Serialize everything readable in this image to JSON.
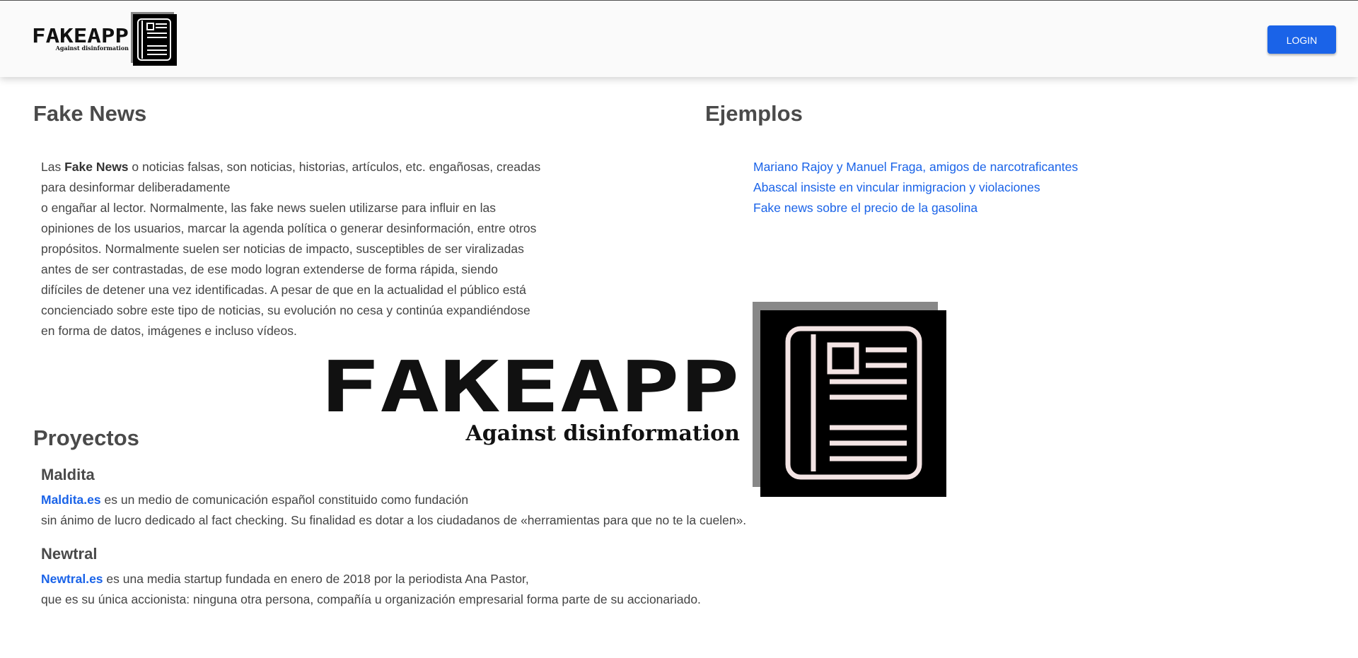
{
  "header": {
    "logo": {
      "word": "FAKEAPP",
      "tagline": "Against disinformation",
      "icon": "newspaper-icon"
    },
    "login_label": "LOGIN"
  },
  "fake_news": {
    "title": "Fake News",
    "intro": "Las ",
    "term": "Fake News",
    "line1_rest": " o noticias falsas, son noticias, historias, artículos, etc. engañosas, creadas",
    "lines": [
      "para desinformar deliberadamente",
      "o engañar al lector. Normalmente, las fake news suelen utilizarse para influir en las",
      "opiniones de los usuarios, marcar la agenda política o generar desinformación, entre otros",
      "propósitos. Normalmente suelen ser noticias de impacto, susceptibles de ser viralizadas",
      "antes de ser contrastadas, de ese modo logran extenderse de forma rápida, siendo",
      "difíciles de detener una vez identificadas. A pesar de que en la actualidad el público está",
      "concienciado sobre este tipo de noticias, su evolución no cesa y continúa expandiéndose",
      "en forma de datos, imágenes e incluso vídeos."
    ]
  },
  "ejemplos": {
    "title": "Ejemplos",
    "links": [
      "Mariano Rajoy y Manuel Fraga, amigos de narcotraficantes",
      "Abascal insiste en vincular inmigracion y violaciones",
      "Fake news sobre el precio de la gasolina"
    ]
  },
  "proyectos": {
    "title": "Proyectos",
    "maldita": {
      "name": "Maldita",
      "link": "Maldita.es",
      "line1": " es un medio de comunicación español constituido como fundación",
      "line2": "sin ánimo de lucro dedicado al fact checking. Su finalidad es dotar a los ciudadanos de «herramientas para que no te la cuelen»."
    },
    "newtral": {
      "name": "Newtral",
      "link": "Newtral.es",
      "line1": " es una media startup fundada en enero de 2018 por la periodista Ana Pastor,",
      "line2": "que es su única accionista: ninguna otra persona, compañía u organización empresarial forma parte de su accionariado."
    }
  },
  "hero_logo": {
    "word": "FAKEAPP",
    "tagline": "Against disinformation",
    "icon": "newspaper-icon"
  },
  "colors": {
    "accent": "#1a63e8",
    "text": "#444444",
    "header_bg": "#fafafa"
  }
}
